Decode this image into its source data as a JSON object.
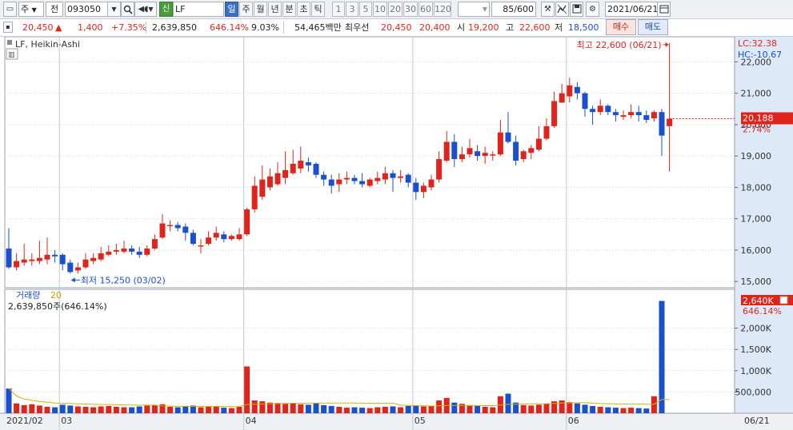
{
  "toolbar": {
    "mode_selector": "주",
    "scope_selector": "전",
    "code": "093050",
    "name_badge": "신",
    "name": "LF",
    "periods": [
      "일",
      "주",
      "월",
      "년",
      "분",
      "초",
      "틱"
    ],
    "active_period": "일",
    "minute_steps": [
      "1",
      "3",
      "5",
      "10",
      "20",
      "30",
      "60",
      "120"
    ],
    "range_label": "85/600",
    "date": "2021/06/21"
  },
  "quote": {
    "price": "20,450",
    "direction": "▲",
    "change": "1,400",
    "change_pct": "+7.35%",
    "volume": "2,639,850",
    "volume_ratio": "646.14%",
    "turnover": "9.03%",
    "amount": "54,465백만",
    "best_label": "최우선",
    "best_ask": "20,450",
    "best_bid": "20,400",
    "open_label": "시",
    "open": "19,200",
    "high_label": "고",
    "high": "22,600",
    "low_label": "저",
    "low": "18,500",
    "buy_label": "매수",
    "sell_label": "매도"
  },
  "price_panel": {
    "legend": "LF, Heikin-Ashi",
    "lc_label": "LC:32.38",
    "hc_label": "HC:-10.67",
    "current_price_tag": "20,188",
    "current_pct_tag": "2.74%",
    "max_annotation": "최고 22,600 (06/21)",
    "min_annotation": "최저 15,250 (03/02)"
  },
  "volume_panel": {
    "title": "거래량",
    "period": "20",
    "sub": "2,639,850주(646.14%)",
    "tag_value": "2,640K",
    "tag_pct": "646.14%"
  },
  "colors": {
    "up": "#e0241b",
    "down": "#1a4fd0",
    "ma": "#d8b200",
    "panel_axis_bg": "#dde9f7",
    "current_tag": "#e0241b"
  },
  "chart_data": {
    "type": "candlestick",
    "style": "Heikin-Ashi",
    "price_axis": {
      "min": 14800,
      "max": 22800,
      "ticks": [
        15000,
        16000,
        17000,
        18000,
        19000,
        20000,
        21000,
        22000
      ],
      "tick_labels": [
        "15,000",
        "16,000",
        "17,000",
        "18,000",
        "19,000",
        "20,000",
        "21,000",
        "22,000"
      ]
    },
    "volume_axis": {
      "min": 0,
      "max": 2800000,
      "ticks": [
        500000,
        1000000,
        1500000,
        2000000
      ],
      "tick_labels": [
        "500,000",
        "1,000K",
        "1,500K",
        "2,000K"
      ]
    },
    "x_labels": [
      {
        "bar": 0,
        "label": "2021/02"
      },
      {
        "bar": 7,
        "label": "03"
      },
      {
        "bar": 31,
        "label": "04"
      },
      {
        "bar": 53,
        "label": "05"
      },
      {
        "bar": 73,
        "label": "06"
      },
      {
        "bar": 91,
        "label": "06/21"
      }
    ],
    "bars": [
      {
        "o": 16050,
        "c": 15450,
        "h": 16700,
        "l": 15400,
        "v": 580000
      },
      {
        "o": 15450,
        "c": 15650,
        "h": 15900,
        "l": 15350,
        "v": 230000
      },
      {
        "o": 15600,
        "c": 15700,
        "h": 16200,
        "l": 15500,
        "v": 190000
      },
      {
        "o": 15650,
        "c": 15700,
        "h": 15900,
        "l": 15500,
        "v": 210000
      },
      {
        "o": 15650,
        "c": 15750,
        "h": 16300,
        "l": 15550,
        "v": 180000
      },
      {
        "o": 15700,
        "c": 15850,
        "h": 16400,
        "l": 15550,
        "v": 150000
      },
      {
        "o": 15850,
        "c": 15800,
        "h": 16000,
        "l": 15600,
        "v": 140000
      },
      {
        "o": 15850,
        "c": 15550,
        "h": 15900,
        "l": 15350,
        "v": 200000
      },
      {
        "o": 15600,
        "c": 15300,
        "h": 15700,
        "l": 15250,
        "v": 180000
      },
      {
        "o": 15350,
        "c": 15450,
        "h": 15600,
        "l": 15250,
        "v": 160000
      },
      {
        "o": 15450,
        "c": 15700,
        "h": 15900,
        "l": 15400,
        "v": 150000
      },
      {
        "o": 15650,
        "c": 15750,
        "h": 15900,
        "l": 15550,
        "v": 140000
      },
      {
        "o": 15700,
        "c": 15900,
        "h": 16100,
        "l": 15650,
        "v": 160000
      },
      {
        "o": 15850,
        "c": 15950,
        "h": 16150,
        "l": 15800,
        "v": 170000
      },
      {
        "o": 15950,
        "c": 16000,
        "h": 16200,
        "l": 15850,
        "v": 150000
      },
      {
        "o": 15950,
        "c": 16050,
        "h": 16300,
        "l": 15900,
        "v": 140000
      },
      {
        "o": 16050,
        "c": 15950,
        "h": 16150,
        "l": 15850,
        "v": 140000
      },
      {
        "o": 15950,
        "c": 15850,
        "h": 16100,
        "l": 15750,
        "v": 160000
      },
      {
        "o": 15850,
        "c": 16050,
        "h": 16150,
        "l": 15800,
        "v": 180000
      },
      {
        "o": 16050,
        "c": 16350,
        "h": 16500,
        "l": 16000,
        "v": 190000
      },
      {
        "o": 16400,
        "c": 16850,
        "h": 17150,
        "l": 16350,
        "v": 210000
      },
      {
        "o": 16800,
        "c": 16800,
        "h": 16950,
        "l": 16600,
        "v": 150000
      },
      {
        "o": 16800,
        "c": 16700,
        "h": 16900,
        "l": 16600,
        "v": 140000
      },
      {
        "o": 16750,
        "c": 16550,
        "h": 16850,
        "l": 16300,
        "v": 160000
      },
      {
        "o": 16550,
        "c": 16200,
        "h": 16650,
        "l": 16150,
        "v": 180000
      },
      {
        "o": 16150,
        "c": 16150,
        "h": 16350,
        "l": 15900,
        "v": 140000
      },
      {
        "o": 16200,
        "c": 16400,
        "h": 16600,
        "l": 16150,
        "v": 150000
      },
      {
        "o": 16400,
        "c": 16550,
        "h": 16750,
        "l": 16300,
        "v": 160000
      },
      {
        "o": 16500,
        "c": 16350,
        "h": 16600,
        "l": 16250,
        "v": 130000
      },
      {
        "o": 16350,
        "c": 16450,
        "h": 16500,
        "l": 16300,
        "v": 120000
      },
      {
        "o": 16350,
        "c": 16500,
        "h": 16700,
        "l": 16300,
        "v": 150000
      },
      {
        "o": 16500,
        "c": 17300,
        "h": 17350,
        "l": 16450,
        "v": 1100000
      },
      {
        "o": 17300,
        "c": 18050,
        "h": 18350,
        "l": 17200,
        "v": 300000
      },
      {
        "o": 17700,
        "c": 18250,
        "h": 18700,
        "l": 17600,
        "v": 280000
      },
      {
        "o": 18000,
        "c": 18350,
        "h": 18600,
        "l": 17900,
        "v": 250000
      },
      {
        "o": 18100,
        "c": 18450,
        "h": 18800,
        "l": 18050,
        "v": 240000
      },
      {
        "o": 18300,
        "c": 18550,
        "h": 19150,
        "l": 18100,
        "v": 220000
      },
      {
        "o": 18450,
        "c": 18750,
        "h": 19200,
        "l": 18400,
        "v": 230000
      },
      {
        "o": 18600,
        "c": 18850,
        "h": 19300,
        "l": 18450,
        "v": 210000
      },
      {
        "o": 18800,
        "c": 18700,
        "h": 18950,
        "l": 18500,
        "v": 200000
      },
      {
        "o": 18750,
        "c": 18400,
        "h": 18800,
        "l": 18300,
        "v": 240000
      },
      {
        "o": 18400,
        "c": 18250,
        "h": 18500,
        "l": 18050,
        "v": 190000
      },
      {
        "o": 18250,
        "c": 18050,
        "h": 18400,
        "l": 17800,
        "v": 170000
      },
      {
        "o": 18100,
        "c": 18250,
        "h": 18450,
        "l": 17850,
        "v": 150000
      },
      {
        "o": 18250,
        "c": 18300,
        "h": 18500,
        "l": 18100,
        "v": 130000
      },
      {
        "o": 18300,
        "c": 18200,
        "h": 18400,
        "l": 18100,
        "v": 140000
      },
      {
        "o": 18200,
        "c": 18100,
        "h": 18450,
        "l": 18000,
        "v": 130000
      },
      {
        "o": 18050,
        "c": 18250,
        "h": 18300,
        "l": 18000,
        "v": 120000
      },
      {
        "o": 18200,
        "c": 18300,
        "h": 18500,
        "l": 18100,
        "v": 140000
      },
      {
        "o": 18250,
        "c": 18450,
        "h": 18650,
        "l": 18100,
        "v": 150000
      },
      {
        "o": 18450,
        "c": 18300,
        "h": 18550,
        "l": 17850,
        "v": 160000
      },
      {
        "o": 18300,
        "c": 18350,
        "h": 18550,
        "l": 18150,
        "v": 140000
      },
      {
        "o": 18400,
        "c": 18150,
        "h": 18450,
        "l": 18000,
        "v": 170000
      },
      {
        "o": 18150,
        "c": 17850,
        "h": 18300,
        "l": 17600,
        "v": 180000
      },
      {
        "o": 17850,
        "c": 18050,
        "h": 18150,
        "l": 17650,
        "v": 160000
      },
      {
        "o": 18000,
        "c": 18250,
        "h": 18400,
        "l": 17900,
        "v": 170000
      },
      {
        "o": 18250,
        "c": 18900,
        "h": 19150,
        "l": 18150,
        "v": 300000
      },
      {
        "o": 18850,
        "c": 19450,
        "h": 19800,
        "l": 18800,
        "v": 360000
      },
      {
        "o": 19450,
        "c": 18900,
        "h": 19700,
        "l": 18650,
        "v": 250000
      },
      {
        "o": 18900,
        "c": 19050,
        "h": 19300,
        "l": 18800,
        "v": 220000
      },
      {
        "o": 19050,
        "c": 19250,
        "h": 19550,
        "l": 18950,
        "v": 180000
      },
      {
        "o": 19150,
        "c": 19000,
        "h": 19350,
        "l": 18850,
        "v": 170000
      },
      {
        "o": 19000,
        "c": 19100,
        "h": 19300,
        "l": 18750,
        "v": 150000
      },
      {
        "o": 19050,
        "c": 19050,
        "h": 19150,
        "l": 18850,
        "v": 140000
      },
      {
        "o": 19050,
        "c": 19750,
        "h": 20150,
        "l": 19000,
        "v": 400000
      },
      {
        "o": 19750,
        "c": 19450,
        "h": 20400,
        "l": 19400,
        "v": 460000
      },
      {
        "o": 19450,
        "c": 18850,
        "h": 19650,
        "l": 18700,
        "v": 250000
      },
      {
        "o": 18900,
        "c": 19150,
        "h": 19200,
        "l": 18800,
        "v": 190000
      },
      {
        "o": 19100,
        "c": 19250,
        "h": 19350,
        "l": 18900,
        "v": 180000
      },
      {
        "o": 19200,
        "c": 19550,
        "h": 19950,
        "l": 19150,
        "v": 200000
      },
      {
        "o": 19550,
        "c": 19950,
        "h": 20200,
        "l": 19500,
        "v": 220000
      },
      {
        "o": 19950,
        "c": 20750,
        "h": 21050,
        "l": 19900,
        "v": 280000
      },
      {
        "o": 20700,
        "c": 21000,
        "h": 21300,
        "l": 20700,
        "v": 300000
      },
      {
        "o": 20900,
        "c": 21250,
        "h": 21500,
        "l": 20700,
        "v": 260000
      },
      {
        "o": 21200,
        "c": 21000,
        "h": 21350,
        "l": 20800,
        "v": 230000
      },
      {
        "o": 21000,
        "c": 20500,
        "h": 21050,
        "l": 20250,
        "v": 200000
      },
      {
        "o": 20500,
        "c": 20400,
        "h": 20600,
        "l": 20000,
        "v": 170000
      },
      {
        "o": 20400,
        "c": 20600,
        "h": 20800,
        "l": 20300,
        "v": 150000
      },
      {
        "o": 20600,
        "c": 20400,
        "h": 20650,
        "l": 20300,
        "v": 140000
      },
      {
        "o": 20400,
        "c": 20300,
        "h": 20500,
        "l": 20100,
        "v": 130000
      },
      {
        "o": 20250,
        "c": 20300,
        "h": 20450,
        "l": 20150,
        "v": 120000
      },
      {
        "o": 20300,
        "c": 20400,
        "h": 20650,
        "l": 20200,
        "v": 130000
      },
      {
        "o": 20400,
        "c": 20300,
        "h": 20600,
        "l": 20100,
        "v": 120000
      },
      {
        "o": 20300,
        "c": 20150,
        "h": 20450,
        "l": 20050,
        "v": 110000
      },
      {
        "o": 20200,
        "c": 20400,
        "h": 20450,
        "l": 20100,
        "v": 400000
      },
      {
        "o": 20400,
        "c": 19650,
        "h": 20500,
        "l": 19000,
        "v": 2639850
      },
      {
        "o": 19950,
        "c": 20188,
        "h": 22600,
        "l": 18500,
        "v": 0
      }
    ]
  }
}
